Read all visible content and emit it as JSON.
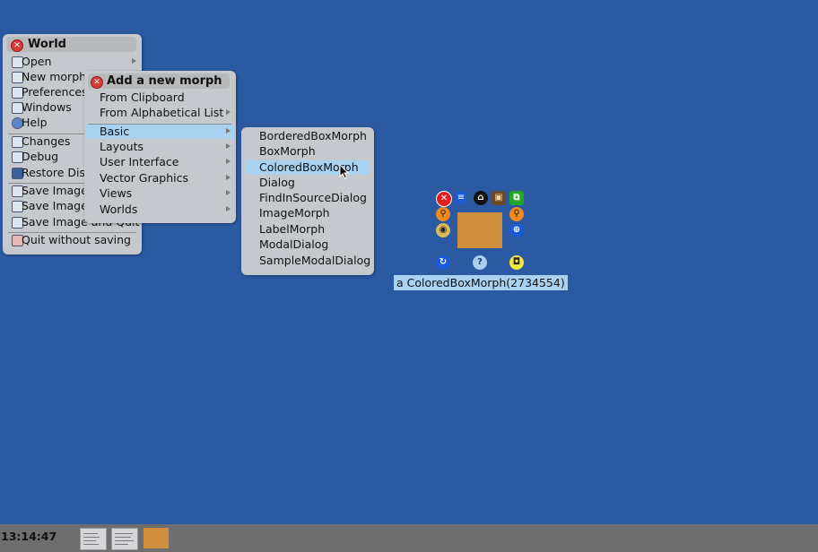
{
  "world_menu": {
    "title": "World",
    "items": [
      {
        "label": "Open",
        "icon": "folder-icon",
        "submenu": true
      },
      {
        "label": "New morph",
        "icon": "new-morph-icon",
        "submenu": false
      },
      {
        "label": "Preferences",
        "icon": "wrench-icon",
        "submenu": false
      },
      {
        "label": "Windows",
        "icon": "windows-icon",
        "submenu": false
      },
      {
        "label": "Help",
        "icon": "help-icon",
        "submenu": false
      },
      {
        "label": "Changes",
        "icon": "changes-icon",
        "submenu": false
      },
      {
        "label": "Debug",
        "icon": "bug-icon",
        "submenu": false
      },
      {
        "label": "Restore Displa",
        "icon": "monitor-icon",
        "submenu": false
      },
      {
        "label": "Save Image",
        "icon": "save-icon",
        "submenu": false
      },
      {
        "label": "Save Image",
        "icon": "save-as-icon",
        "submenu": false
      },
      {
        "label": "Save Image and Quit",
        "icon": "save-quit-icon",
        "submenu": false
      },
      {
        "label": "Quit without saving",
        "icon": "quit-icon",
        "submenu": false
      }
    ]
  },
  "add_menu": {
    "title": "Add a new morph",
    "items": [
      {
        "label": "From Clipboard",
        "submenu": false
      },
      {
        "label": "From Alphabetical List",
        "submenu": true
      },
      {
        "label": "Basic",
        "submenu": true,
        "selected": true
      },
      {
        "label": "Layouts",
        "submenu": true
      },
      {
        "label": "User Interface",
        "submenu": true
      },
      {
        "label": "Vector Graphics",
        "submenu": true
      },
      {
        "label": "Views",
        "submenu": true
      },
      {
        "label": "Worlds",
        "submenu": true
      }
    ]
  },
  "basic_menu": {
    "items": [
      {
        "label": "BorderedBoxMorph"
      },
      {
        "label": "BoxMorph"
      },
      {
        "label": "ColoredBoxMorph",
        "selected": true
      },
      {
        "label": "Dialog"
      },
      {
        "label": "FindInSourceDialog"
      },
      {
        "label": "ImageMorph"
      },
      {
        "label": "LabelMorph"
      },
      {
        "label": "ModalDialog"
      },
      {
        "label": "SampleModalDialog"
      }
    ]
  },
  "morph": {
    "label": "a ColoredBoxMorph(2734554)",
    "color": "#cf8d3e"
  },
  "halo_handles": [
    {
      "name": "halo-remove-icon",
      "color": "#e02020",
      "glyph": "✕"
    },
    {
      "name": "halo-menu-icon",
      "color": "#1c5bd6",
      "glyph": "≡"
    },
    {
      "name": "halo-grab-icon",
      "color": "#111111",
      "glyph": "⌂"
    },
    {
      "name": "halo-drag-icon",
      "color": "#6b4a2a",
      "glyph": "▣"
    },
    {
      "name": "halo-duplicate-icon",
      "color": "#26a626",
      "glyph": "⧉"
    },
    {
      "name": "halo-debug-icon",
      "color": "#f08a1c",
      "glyph": "⚲"
    },
    {
      "name": "halo-inspect-icon",
      "color": "#f08a1c",
      "glyph": "⚲"
    },
    {
      "name": "halo-collapse-icon",
      "color": "#d9b85a",
      "glyph": "◉"
    },
    {
      "name": "halo-scale-icon",
      "color": "#1c5bd6",
      "glyph": "⊕"
    },
    {
      "name": "halo-rotate-icon",
      "color": "#1c5bd6",
      "glyph": "↻"
    },
    {
      "name": "halo-help-icon",
      "color": "#a9cef0",
      "glyph": "?"
    },
    {
      "name": "halo-resize-icon",
      "color": "#f2e83a",
      "glyph": "◘"
    }
  ],
  "taskbar": {
    "clock": "13:14:47",
    "swatch_color": "#cf8d3e"
  }
}
